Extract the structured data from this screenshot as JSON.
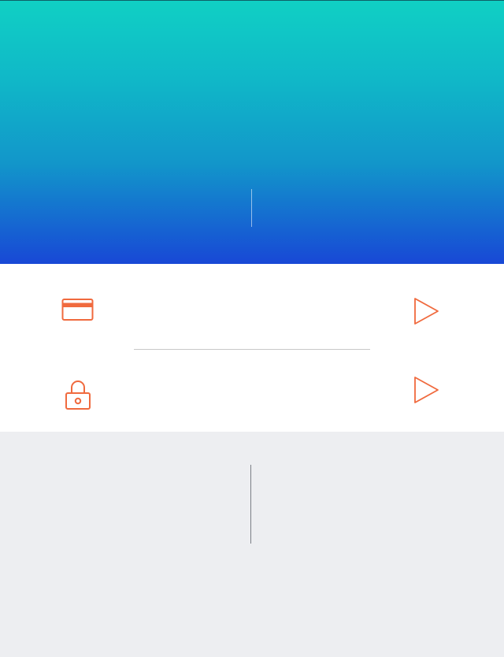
{
  "theme": {
    "accent": "#f06a3e",
    "gradient_top": "#10d0c4",
    "gradient_bottom": "#1848d6",
    "page_background": "#edeef1",
    "card_background": "#ffffff"
  },
  "menu": {
    "items": [
      {
        "icon": "credit-card-icon",
        "label": "",
        "action_icon": "play-arrow-icon"
      },
      {
        "icon": "padlock-icon",
        "label": "",
        "action_icon": "play-arrow-icon"
      }
    ]
  }
}
